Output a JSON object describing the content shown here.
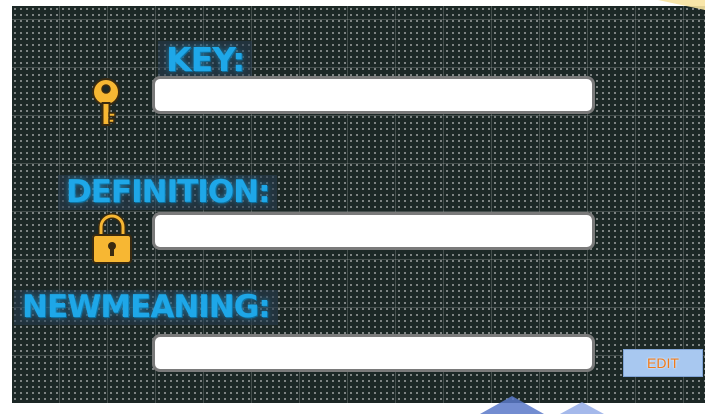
{
  "labels": {
    "key": "KEY:",
    "definition": "DEFINITION:",
    "new_meaning": "NEWMEANING:"
  },
  "fields": {
    "key": {
      "value": "",
      "placeholder": ""
    },
    "definition": {
      "value": "",
      "placeholder": ""
    },
    "new_meaning": {
      "value": "",
      "placeholder": ""
    }
  },
  "buttons": {
    "edit": "EDIT"
  },
  "icons": {
    "key": "key-icon",
    "lock": "lock-icon"
  },
  "colors": {
    "background": "#1c2826",
    "label_text": "#1ea7e8",
    "edit_button_bg": "#a8c8f0",
    "edit_button_text": "#f07a1a",
    "icon_fill": "#f7b733"
  }
}
